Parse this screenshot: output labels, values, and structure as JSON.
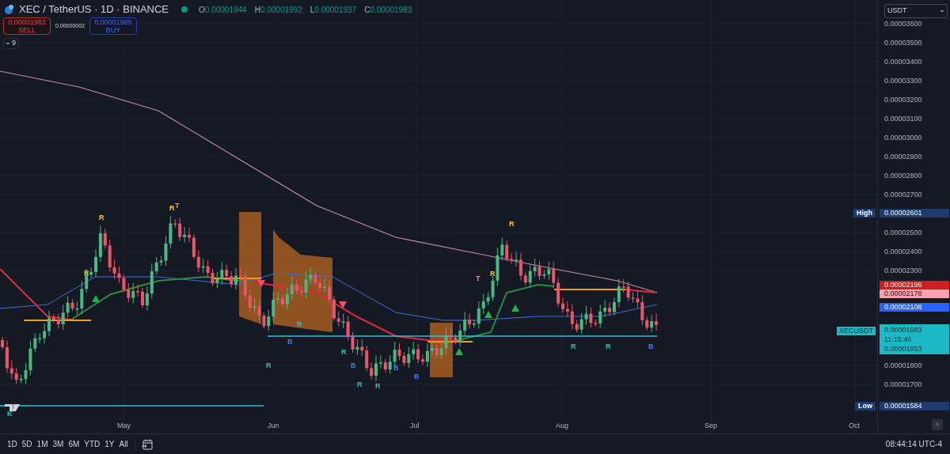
{
  "header": {
    "title": "XEC / TetherUS · 1D · BINANCE",
    "ohlc": [
      {
        "label": "O",
        "value": "0.00001944"
      },
      {
        "label": "H",
        "value": "0.00001992"
      },
      {
        "label": "L",
        "value": "0.00001937"
      },
      {
        "label": "C",
        "value": "0.00001983"
      }
    ]
  },
  "trade": {
    "sell": {
      "price": "0.00001983",
      "label": "SELL"
    },
    "spread": "0.00000002",
    "buy": {
      "price": "0.00001985",
      "label": "BUY"
    }
  },
  "indicators_toggle": {
    "count": "9"
  },
  "price_scale": {
    "currency": "USDT",
    "ticks": [
      "0.00003600",
      "0.00003500",
      "0.00003400",
      "0.00003300",
      "0.00003200",
      "0.00003100",
      "0.00003000",
      "0.00002900",
      "0.00002800",
      "0.00002700",
      "0.00002500",
      "0.00002400",
      "0.00002300",
      "0.00001800",
      "0.00001700"
    ],
    "markers": [
      {
        "kind": "extreme",
        "label": "High",
        "value": "0.00002601",
        "color": "#1e3a6e"
      },
      {
        "kind": "level",
        "value": "0.00002196",
        "color": "#cc1f1f"
      },
      {
        "kind": "level",
        "value": "0.00002178",
        "color": "#f7a1b0"
      },
      {
        "kind": "level",
        "value": "0.00002108",
        "color": "#2962ff"
      },
      {
        "kind": "current",
        "label": "XECUSDT",
        "value": "0.00001983",
        "countdown": "11:15:46",
        "second_value": "0.00001953",
        "color": "#1bb8c6"
      },
      {
        "kind": "extreme",
        "label": "Low",
        "value": "0.00001584",
        "color": "#1e3a6e"
      }
    ],
    "auto_button": "A"
  },
  "time_axis": {
    "months": [
      "May",
      "Jun",
      "Jul",
      "Aug",
      "Sep",
      "Oct"
    ]
  },
  "signals": [
    {
      "text": "R",
      "color": "#f5c542"
    },
    {
      "text": "R",
      "color": "#f5c542"
    },
    {
      "text": "R",
      "color": "#f5c542"
    },
    {
      "text": "T",
      "color": "#f59e42"
    },
    {
      "text": "R",
      "color": "#26c6b0"
    },
    {
      "text": "R",
      "color": "#26c6b0"
    },
    {
      "text": "B",
      "color": "#3d7bf5"
    },
    {
      "text": "R",
      "color": "#26c6b0"
    },
    {
      "text": "B",
      "color": "#3d7bf5"
    },
    {
      "text": "R",
      "color": "#26c6b0"
    },
    {
      "text": "R",
      "color": "#26c6b0"
    },
    {
      "text": "B",
      "color": "#3d7bf5"
    },
    {
      "text": "B",
      "color": "#3d7bf5"
    },
    {
      "text": "T",
      "color": "#f59e42"
    },
    {
      "text": "R",
      "color": "#f5c542"
    },
    {
      "text": "R",
      "color": "#f5c542"
    },
    {
      "text": "R",
      "color": "#26c6b0"
    },
    {
      "text": "R",
      "color": "#26c6b0"
    },
    {
      "text": "B",
      "color": "#3d7bf5"
    },
    {
      "text": "K",
      "color": "#26c6b0"
    }
  ],
  "bottom_bar": {
    "ranges": [
      "1D",
      "5D",
      "1M",
      "3M",
      "6M",
      "YTD",
      "1Y",
      "All"
    ],
    "clock": "08:44:14 UTC-4"
  }
}
